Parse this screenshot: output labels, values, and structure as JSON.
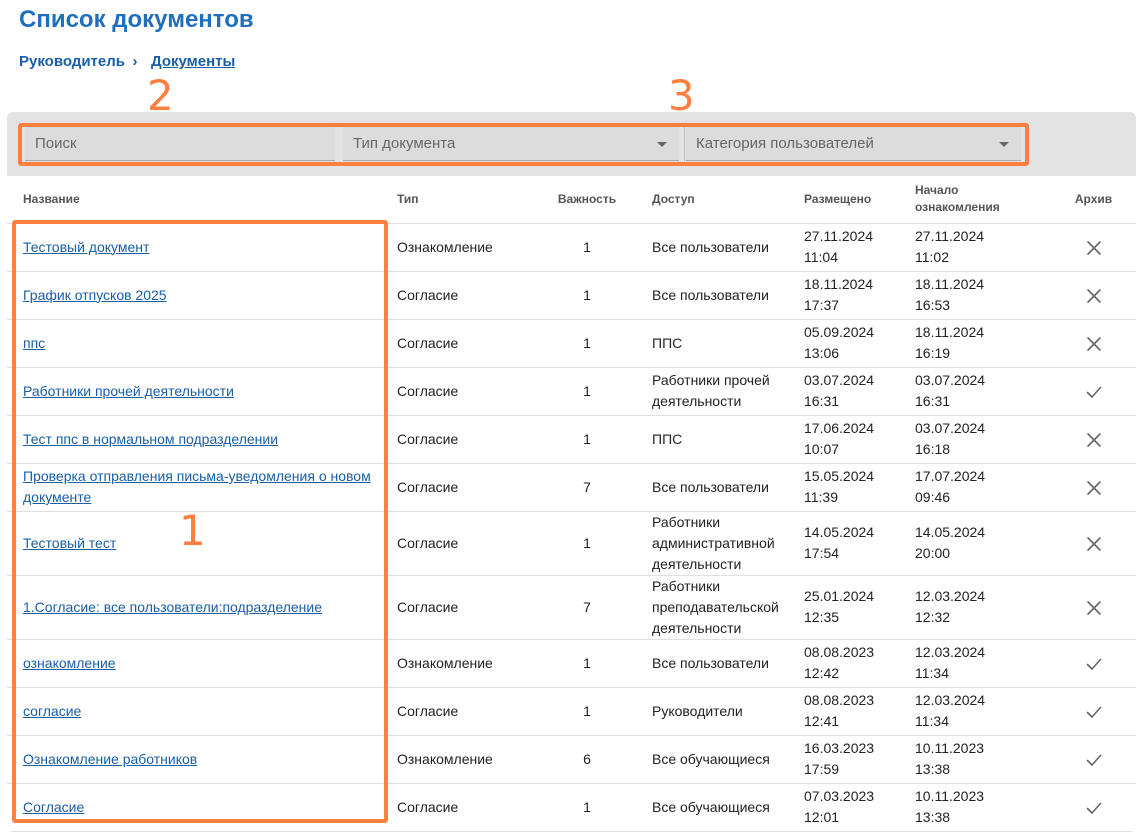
{
  "page_title": "Список документов",
  "breadcrumb": {
    "parent": "Руководитель",
    "current": "Документы",
    "separator": "›"
  },
  "annotations": {
    "filters_left": "2",
    "filters_right": "3",
    "names": "1"
  },
  "filters": {
    "search_placeholder": "Поиск",
    "doc_type_placeholder": "Тип документа",
    "user_category_placeholder": "Категория пользователей"
  },
  "table": {
    "headers": {
      "name": "Название",
      "type": "Тип",
      "importance": "Важность",
      "access": "Доступ",
      "published": "Размещено",
      "start_line1": "Начало",
      "start_line2": "ознакомления",
      "archive": "Архив"
    },
    "rows": [
      {
        "name": "Тестовый документ",
        "type": "Ознакомление",
        "importance": "1",
        "access": "Все пользователи",
        "published_date": "27.11.2024",
        "published_time": "11:04",
        "start_date": "27.11.2024",
        "start_time": "11:02",
        "archived": false
      },
      {
        "name": "График отпусков 2025",
        "type": "Согласие",
        "importance": "1",
        "access": "Все пользователи",
        "published_date": "18.11.2024",
        "published_time": "17:37",
        "start_date": "18.11.2024",
        "start_time": "16:53",
        "archived": false
      },
      {
        "name": "ппс",
        "type": "Согласие",
        "importance": "1",
        "access": "ППС",
        "published_date": "05.09.2024",
        "published_time": "13:06",
        "start_date": "18.11.2024",
        "start_time": "16:19",
        "archived": false
      },
      {
        "name": "Работники прочей деятельности",
        "type": "Согласие",
        "importance": "1",
        "access": "Работники прочей деятельности",
        "published_date": "03.07.2024",
        "published_time": "16:31",
        "start_date": "03.07.2024",
        "start_time": "16:31",
        "archived": true
      },
      {
        "name": "Тест ппс в нормальном подразделении",
        "type": "Согласие",
        "importance": "1",
        "access": "ППС",
        "published_date": "17.06.2024",
        "published_time": "10:07",
        "start_date": "03.07.2024",
        "start_time": "16:18",
        "archived": false
      },
      {
        "name": "Проверка отправления письма-уведомления о новом документе",
        "type": "Согласие",
        "importance": "7",
        "access": "Все пользователи",
        "published_date": "15.05.2024",
        "published_time": "11:39",
        "start_date": "17.07.2024",
        "start_time": "09:46",
        "archived": false
      },
      {
        "name": "Тестовый тест",
        "type": "Согласие",
        "importance": "1",
        "access": "Работники административной деятельности",
        "published_date": "14.05.2024",
        "published_time": "17:54",
        "start_date": "14.05.2024",
        "start_time": "20:00",
        "archived": false
      },
      {
        "name": "1.Согласие: все пользователи:подразделение",
        "type": "Согласие",
        "importance": "7",
        "access": "Работники преподавательской деятельности",
        "published_date": "25.01.2024",
        "published_time": "12:35",
        "start_date": "12.03.2024",
        "start_time": "12:32",
        "archived": false
      },
      {
        "name": "ознакомление",
        "type": "Ознакомление",
        "importance": "1",
        "access": "Все пользователи",
        "published_date": "08.08.2023",
        "published_time": "12:42",
        "start_date": "12.03.2024",
        "start_time": "11:34",
        "archived": true
      },
      {
        "name": "согласие",
        "type": "Согласие",
        "importance": "1",
        "access": "Руководители",
        "published_date": "08.08.2023",
        "published_time": "12:41",
        "start_date": "12.03.2024",
        "start_time": "11:34",
        "archived": true
      },
      {
        "name": "Ознакомление работников",
        "type": "Ознакомление",
        "importance": "6",
        "access": "Все обучающиеся",
        "published_date": "16.03.2023",
        "published_time": "17:59",
        "start_date": "10.11.2023",
        "start_time": "13:38",
        "archived": true
      },
      {
        "name": "Согласие",
        "type": "Согласие",
        "importance": "1",
        "access": "Все обучающиеся",
        "published_date": "07.03.2023",
        "published_time": "12:01",
        "start_date": "10.11.2023",
        "start_time": "13:38",
        "archived": true
      }
    ]
  },
  "colors": {
    "title": "#1f6fbf",
    "link": "#1a5ea8",
    "annotation": "#ff7f3f",
    "filter_bg": "#e3e3e3"
  },
  "icons": {
    "archived_true": "check-icon",
    "archived_false": "close-icon"
  }
}
